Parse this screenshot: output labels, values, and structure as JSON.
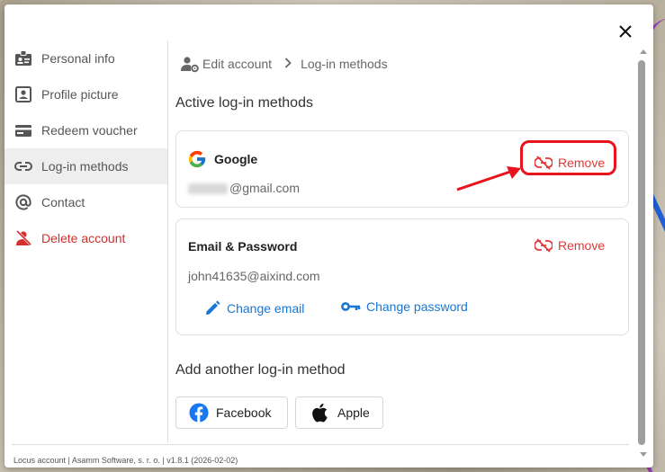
{
  "dialog": {
    "close_icon": "close-icon"
  },
  "sidebar": {
    "items": [
      {
        "label": "Personal info",
        "icon": "id-badge-icon"
      },
      {
        "label": "Profile picture",
        "icon": "portrait-icon"
      },
      {
        "label": "Redeem voucher",
        "icon": "voucher-card-icon"
      },
      {
        "label": "Log-in methods",
        "icon": "link-icon"
      },
      {
        "label": "Contact",
        "icon": "at-sign-icon"
      },
      {
        "label": "Delete account",
        "icon": "person-remove-icon"
      }
    ],
    "active_index": 3,
    "danger_color": "#d32f2f"
  },
  "breadcrumb": {
    "parent": "Edit account",
    "current": "Log-in methods"
  },
  "active_section": {
    "title": "Active log-in methods"
  },
  "google_card": {
    "title": "Google",
    "email_suffix": "@gmail.com",
    "remove_label": "Remove"
  },
  "email_card": {
    "title": "Email & Password",
    "email": "john41635@aixind.com",
    "remove_label": "Remove",
    "change_email_label": "Change email",
    "change_password_label": "Change password"
  },
  "add_section": {
    "title": "Add another log-in method",
    "facebook_label": "Facebook",
    "apple_label": "Apple"
  },
  "footer": {
    "text": "Locus account | Asamm Software, s. r. o. | v1.8.1 (2026-02-02)"
  },
  "colors": {
    "remove": "#e53935",
    "link": "#1976d2",
    "highlight": "#e8131b",
    "facebook": "#1877f2"
  }
}
